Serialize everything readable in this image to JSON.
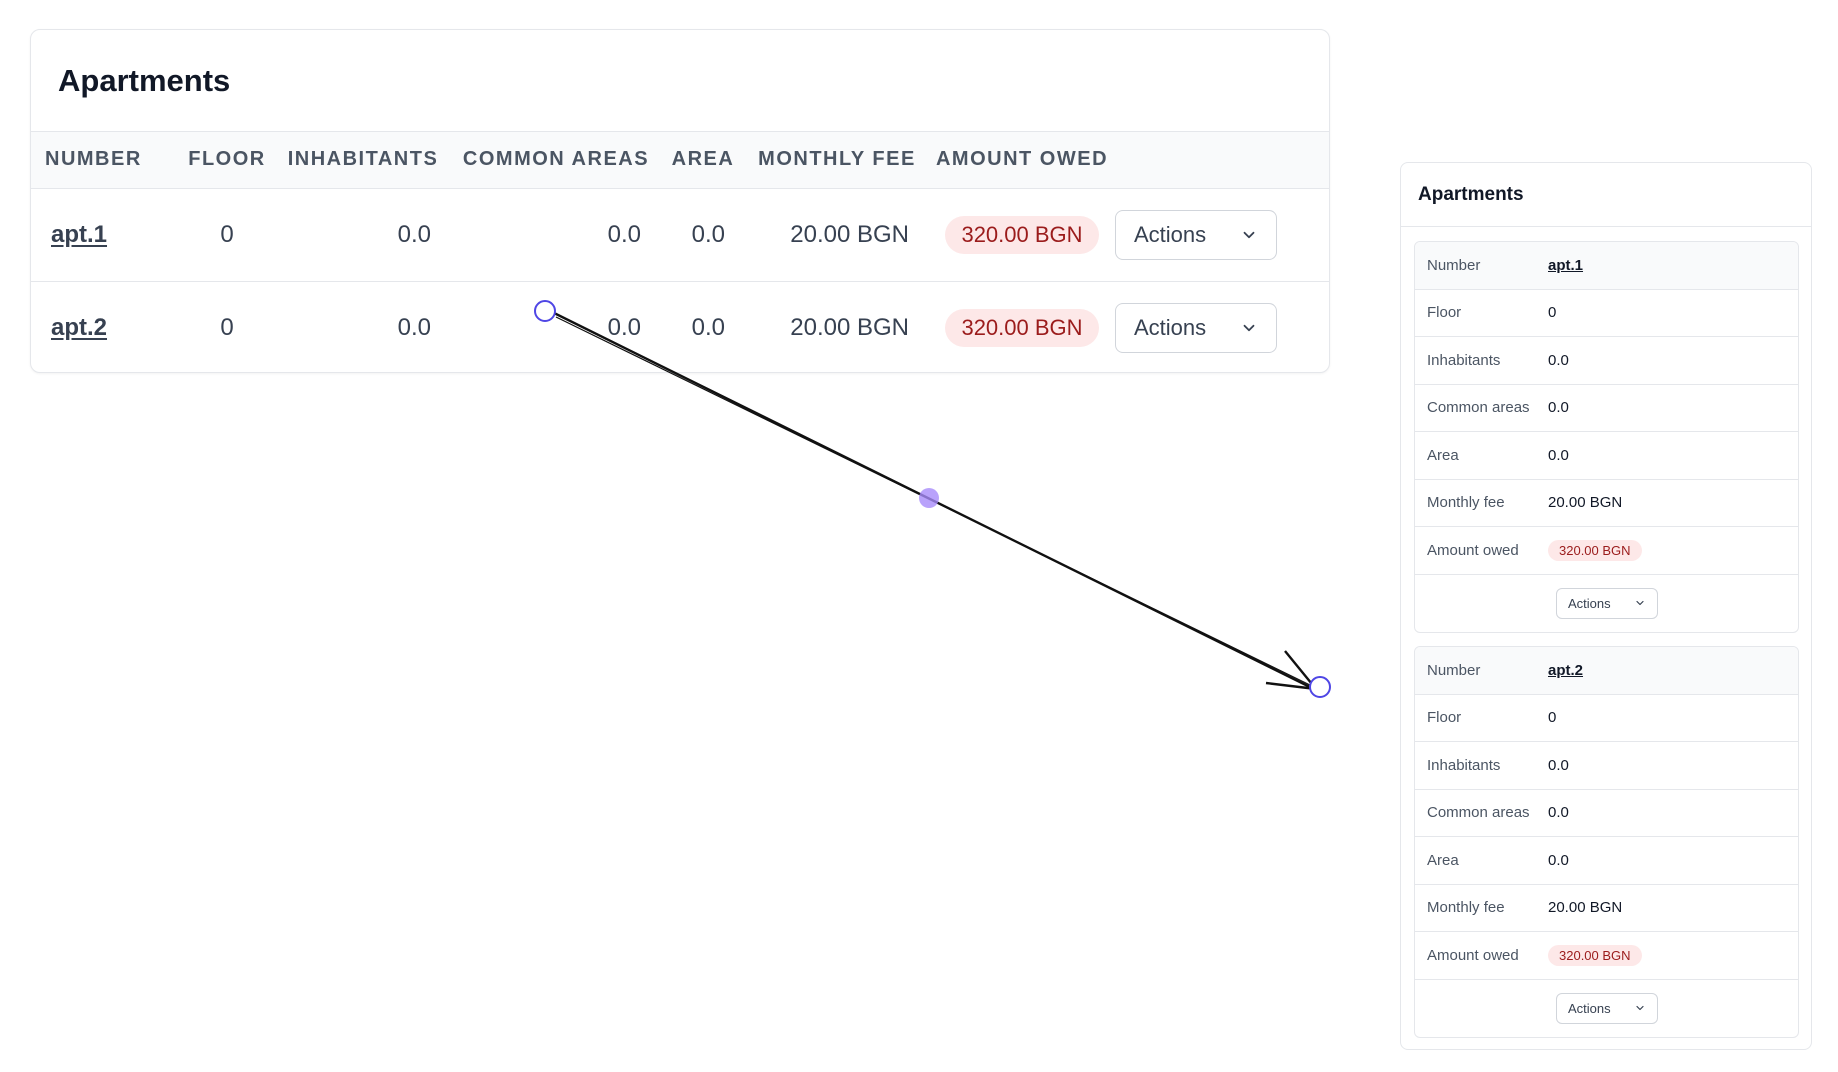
{
  "main": {
    "title": "Apartments",
    "columns": [
      "NUMBER",
      "FLOOR",
      "INHABITANTS",
      "COMMON AREAS",
      "AREA",
      "MONTHLY FEE",
      "AMOUNT OWED"
    ],
    "rows": [
      {
        "number": "apt.1",
        "floor": "0",
        "inhabitants": "0.0",
        "common_areas": "0.0",
        "area": "0.0",
        "monthly_fee": "20.00 BGN",
        "amount_owed": "320.00 BGN",
        "actions_label": "Actions"
      },
      {
        "number": "apt.2",
        "floor": "0",
        "inhabitants": "0.0",
        "common_areas": "0.0",
        "area": "0.0",
        "monthly_fee": "20.00 BGN",
        "amount_owed": "320.00 BGN",
        "actions_label": "Actions"
      }
    ]
  },
  "side": {
    "title": "Apartments",
    "labels": {
      "number": "Number",
      "floor": "Floor",
      "inhabitants": "Inhabitants",
      "common_areas": "Common areas",
      "area": "Area",
      "monthly_fee": "Monthly fee",
      "amount_owed": "Amount owed"
    }
  },
  "icons": {
    "chevron": "chevron-down-icon"
  },
  "colors": {
    "badge_bg": "#fde8e8",
    "badge_text": "#9b1c1c",
    "drag_handle": "#4f46e5",
    "drag_midpoint": "#a78bfa"
  }
}
